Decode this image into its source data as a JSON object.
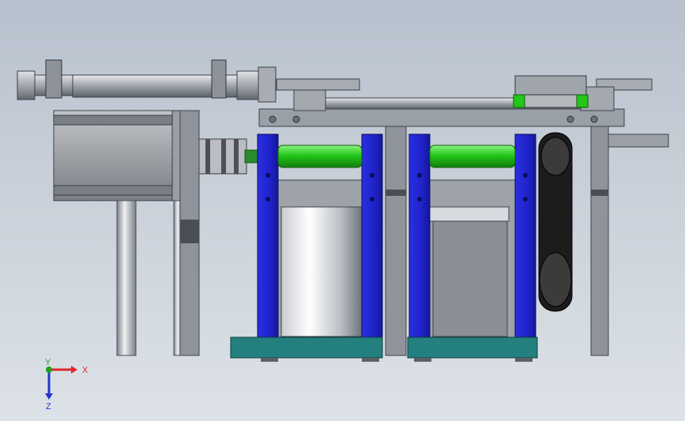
{
  "viewport": {
    "background_top": "#b7c1cd",
    "background_bottom": "#dde2e8"
  },
  "colors": {
    "frame_gray": "#8f949c",
    "frame_dark": "#5e636b",
    "blue_bracket": "#1f23c9",
    "green_roller": "#22c71a",
    "teal_base": "#23807f",
    "belt_black": "#1c1c1c",
    "motor_gray": "#9ea1a6"
  },
  "triad": {
    "x_label": "X",
    "y_label": "Y",
    "z_label": "Z",
    "x_color": "#e0262a",
    "y_color": "#1fa21f",
    "z_color": "#2535c8"
  },
  "icons": {
    "triad": "axis-triad-icon"
  }
}
